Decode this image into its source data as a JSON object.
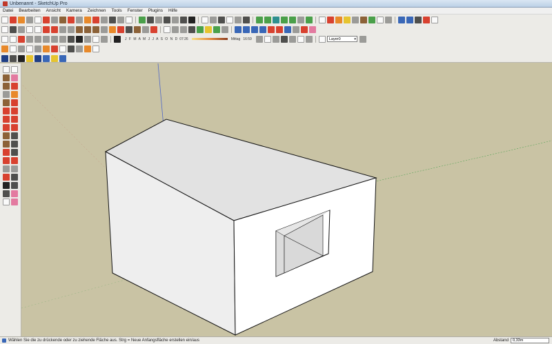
{
  "window": {
    "title": "Unbenannt - SketchUp Pro"
  },
  "menu": {
    "items": [
      "Datei",
      "Bearbeiten",
      "Ansicht",
      "Kamera",
      "Zeichnen",
      "Tools",
      "Fenster",
      "Plugins",
      "Hilfe"
    ]
  },
  "shadows": {
    "months": "J F M A M J J A S O N D",
    "time_start": "07:26",
    "time_label": "Mittag",
    "time_end": "16:59"
  },
  "layers": {
    "current": "Layer0"
  },
  "status": {
    "message": "Wählen Sie die zu drückende oder zu ziehende Fläche aus. Strg = Neue Anfangsfläche erstellen ein/aus",
    "measure_label": "Abstand",
    "measure_value": "0,33m"
  },
  "colors": {
    "viewport_ground": "#c9c3a4",
    "face_front": "#ffffff",
    "face_side": "#eeeeee",
    "face_roof": "#e2e2e2",
    "axis_blue": "#5068c8",
    "axis_green": "#5aa55a",
    "axis_red": "#c05050"
  }
}
